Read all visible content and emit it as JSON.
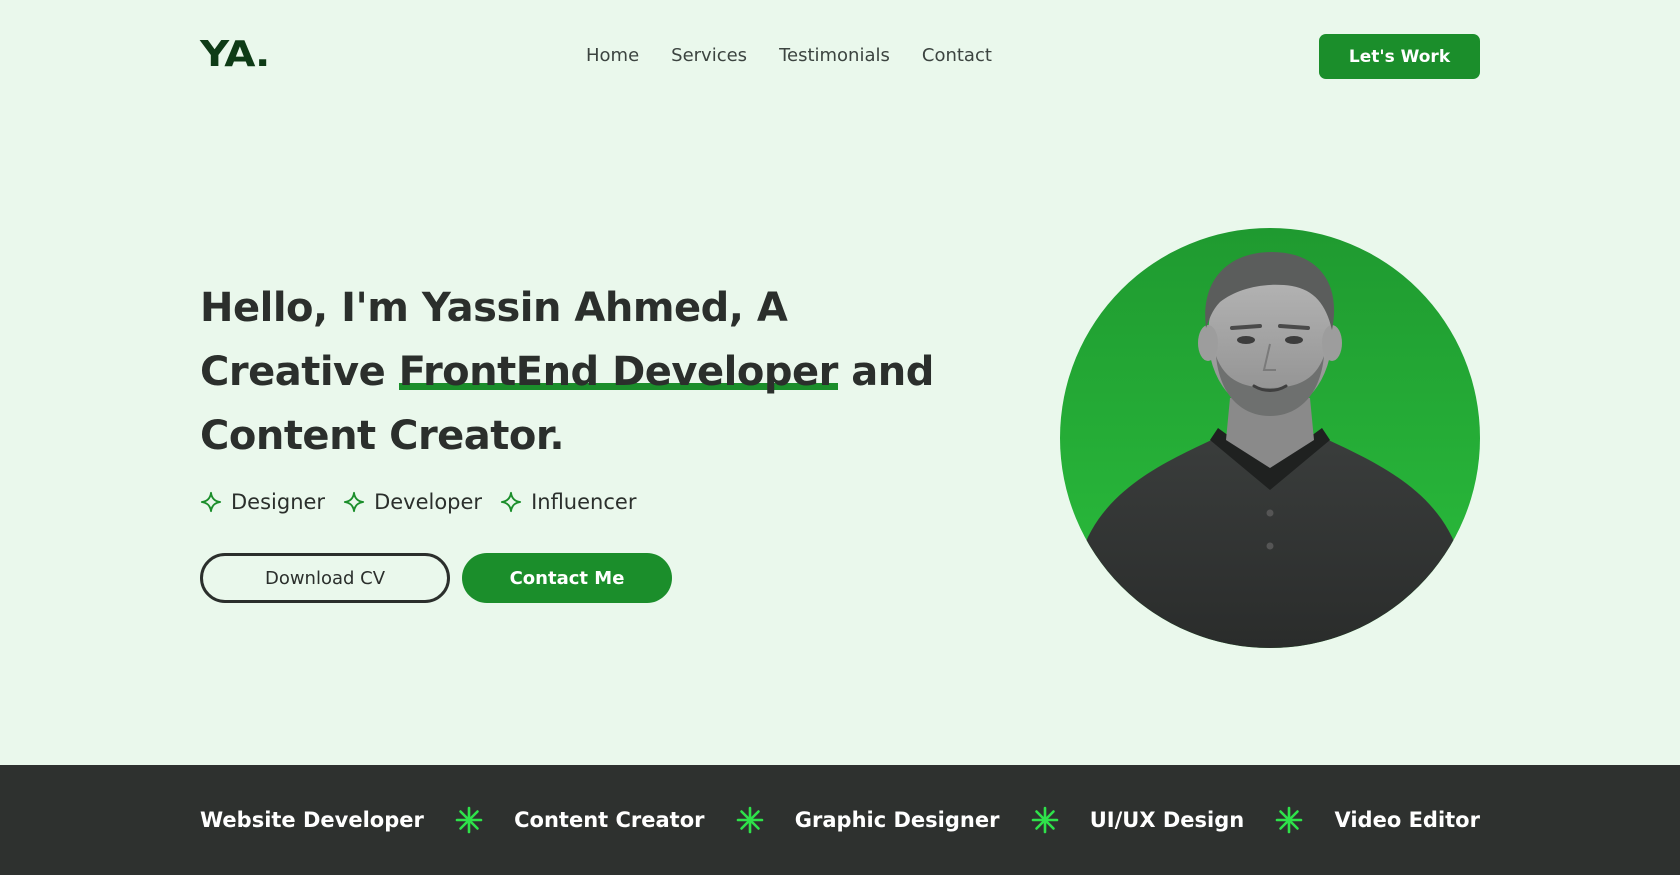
{
  "brand": {
    "logo": "YA."
  },
  "nav": {
    "items": [
      {
        "label": "Home"
      },
      {
        "label": "Services"
      },
      {
        "label": "Testimonials"
      },
      {
        "label": "Contact"
      }
    ],
    "cta_label": "Let's Work"
  },
  "hero": {
    "headline_before": "Hello, I'm Yassin Ahmed, A Creative ",
    "headline_highlight": "FrontEnd Developer",
    "headline_after": " and Content Creator.",
    "roles": [
      {
        "label": "Designer",
        "icon": "sparkle-outline-icon"
      },
      {
        "label": "Developer",
        "icon": "sparkle-outline-icon"
      },
      {
        "label": "Influencer",
        "icon": "sparkle-outline-icon"
      }
    ],
    "download_label": "Download CV",
    "contact_label": "Contact Me",
    "portrait_icon": "profile-photo"
  },
  "band": {
    "items": [
      {
        "label": "Website Developer"
      },
      {
        "label": "Content Creator"
      },
      {
        "label": "Graphic Designer"
      },
      {
        "label": "UI/UX Design"
      },
      {
        "label": "Video Editor"
      }
    ],
    "separator_icon": "asterisk-star-icon"
  },
  "colors": {
    "background": "#eaf8ec",
    "accent": "#1b8e2b",
    "dark": "#2e312f",
    "spark": "#2ee24a"
  }
}
